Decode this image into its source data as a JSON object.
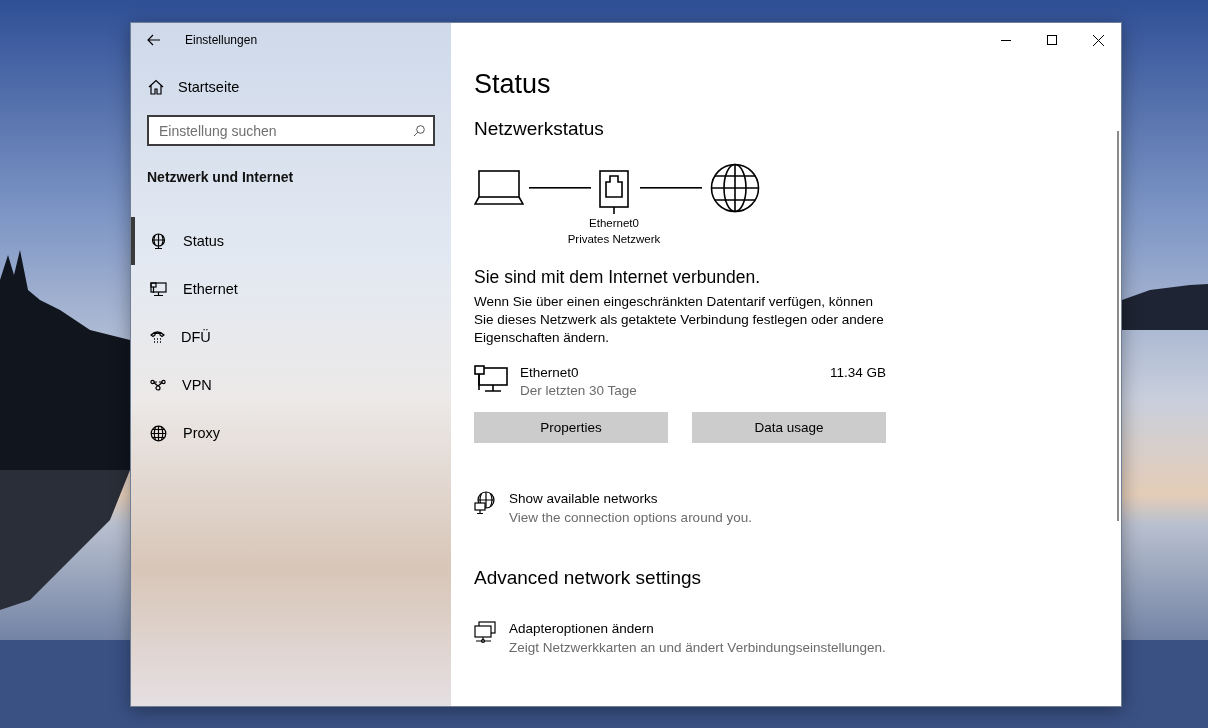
{
  "window": {
    "title": "Einstellungen"
  },
  "sidebar": {
    "home": "Startseite",
    "search": {
      "placeholder": "Einstellung suchen"
    },
    "section": "Netzwerk und Internet",
    "items": [
      {
        "label": "Status",
        "kind": "status",
        "selected": true
      },
      {
        "label": "Ethernet",
        "kind": "ethernet",
        "selected": false
      },
      {
        "label": "DFÜ",
        "kind": "dialup",
        "selected": false
      },
      {
        "label": "VPN",
        "kind": "vpn",
        "selected": false
      },
      {
        "label": "Proxy",
        "kind": "proxy",
        "selected": false
      }
    ]
  },
  "page": {
    "title": "Status",
    "network_status": {
      "heading": "Netzwerkstatus",
      "adapter": "Ethernet0",
      "profile": "Privates Netzwerk"
    },
    "message": "Sie sind mit dem Internet verbunden.",
    "description": "Wenn Sie über einen eingeschränkten Datentarif verfügen, können Sie dieses Netzwerk als getaktete Verbindung festlegen oder andere Eigenschaften ändern.",
    "connection": {
      "name": "Ethernet0",
      "period": "Der letzten 30 Tage",
      "usage": "11.34 GB"
    },
    "buttons": [
      "Properties",
      "Data usage"
    ],
    "links": [
      {
        "kind": "networks",
        "title": "Show available networks",
        "subtitle": "View the connection options around you."
      }
    ],
    "advanced_heading": "Advanced network settings",
    "advanced_links": [
      {
        "kind": "adapter",
        "title": "Adapteroptionen ändern",
        "subtitle": "Zeigt Netzwerkkarten an und ändert Verbindungseinstellungen."
      }
    ]
  }
}
